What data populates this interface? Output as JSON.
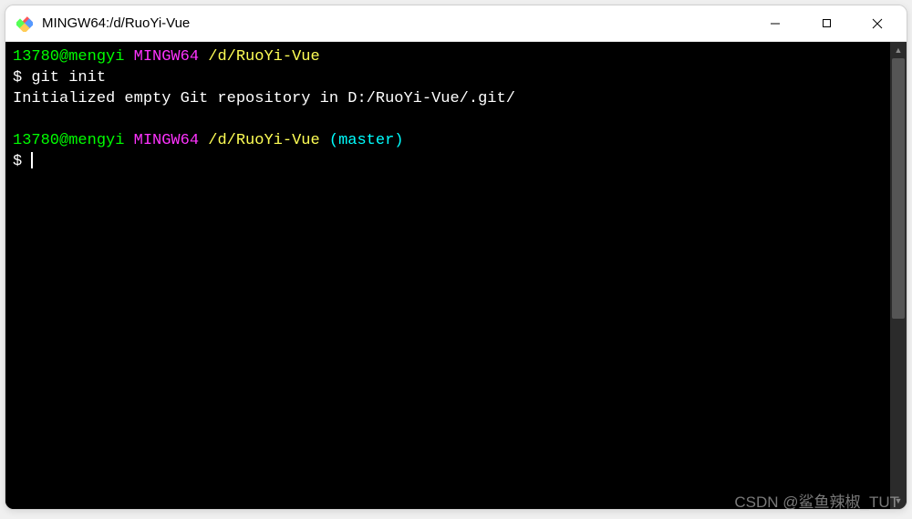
{
  "window": {
    "title": "MINGW64:/d/RuoYi-Vue"
  },
  "prompt1": {
    "user_host": "13780@mengyi",
    "env": "MINGW64",
    "cwd": "/d/RuoYi-Vue",
    "symbol": "$",
    "command": "git init"
  },
  "output1": "Initialized empty Git repository in D:/RuoYi-Vue/.git/",
  "prompt2": {
    "user_host": "13780@mengyi",
    "env": "MINGW64",
    "cwd": "/d/RuoYi-Vue",
    "branch": "(master)",
    "symbol": "$"
  },
  "watermark": "CSDN @鲨鱼辣椒_TUT"
}
